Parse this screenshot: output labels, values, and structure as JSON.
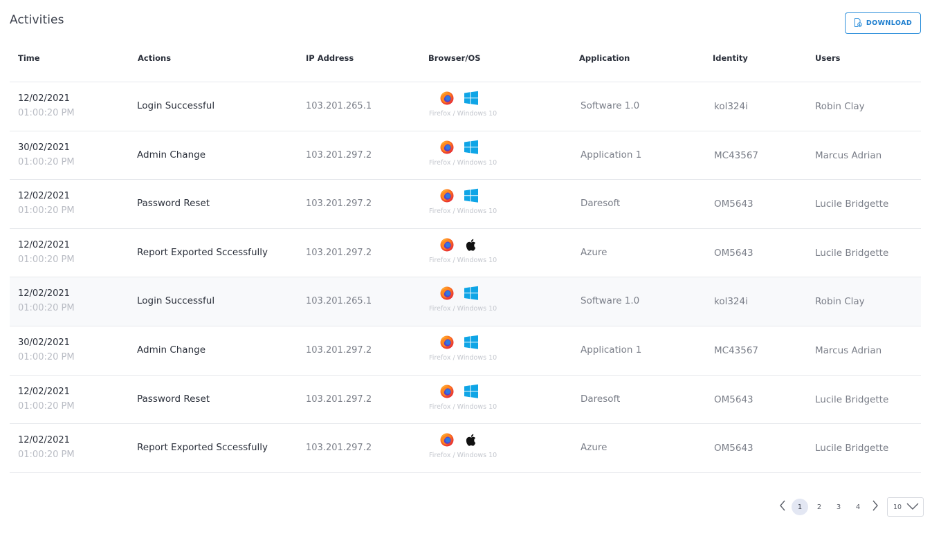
{
  "page": {
    "title": "Activities",
    "download_label": "DOWNLOAD"
  },
  "table": {
    "columns": [
      "Time",
      "Actions",
      "IP Address",
      "Browser/OS",
      "Application",
      "Identity",
      "Users"
    ],
    "rows": [
      {
        "date": "12/02/2021",
        "time": "01:00:20 PM",
        "action": "Login Successful",
        "ip": "103.201.265.1",
        "browser_icon": "firefox-icon",
        "os_icon": "windows-icon",
        "browser_os": "Firefox / Windows 10",
        "application": "Software 1.0",
        "identity": "kol324i",
        "user": "Robin Clay"
      },
      {
        "date": "30/02/2021",
        "time": "01:00:20 PM",
        "action": "Admin Change",
        "ip": "103.201.297.2",
        "browser_icon": "firefox-icon",
        "os_icon": "windows-icon",
        "browser_os": "Firefox / Windows 10",
        "application": "Application 1",
        "identity": "MC43567",
        "user": "Marcus Adrian"
      },
      {
        "date": "12/02/2021",
        "time": "01:00:20 PM",
        "action": "Password Reset",
        "ip": "103.201.297.2",
        "browser_icon": "firefox-icon",
        "os_icon": "windows-icon",
        "browser_os": "Firefox / Windows 10",
        "application": "Daresoft",
        "identity": "OM5643",
        "user": "Lucile Bridgette"
      },
      {
        "date": "12/02/2021",
        "time": "01:00:20 PM",
        "action": "Report Exported Sccessfully",
        "ip": "103.201.297.2",
        "browser_icon": "firefox-icon",
        "os_icon": "apple-icon",
        "browser_os": "Firefox / Windows 10",
        "application": "Azure",
        "identity": "OM5643",
        "user": "Lucile Bridgette"
      },
      {
        "date": "12/02/2021",
        "time": "01:00:20 PM",
        "action": "Login Successful",
        "ip": "103.201.265.1",
        "browser_icon": "firefox-icon",
        "os_icon": "windows-icon",
        "browser_os": "Firefox / Windows 10",
        "application": "Software 1.0",
        "identity": "kol324i",
        "user": "Robin Clay"
      },
      {
        "date": "30/02/2021",
        "time": "01:00:20 PM",
        "action": "Admin Change",
        "ip": "103.201.297.2",
        "browser_icon": "firefox-icon",
        "os_icon": "windows-icon",
        "browser_os": "Firefox / Windows 10",
        "application": "Application 1",
        "identity": "MC43567",
        "user": "Marcus Adrian"
      },
      {
        "date": "12/02/2021",
        "time": "01:00:20 PM",
        "action": "Password Reset",
        "ip": "103.201.297.2",
        "browser_icon": "firefox-icon",
        "os_icon": "windows-icon",
        "browser_os": "Firefox / Windows 10",
        "application": "Daresoft",
        "identity": "OM5643",
        "user": "Lucile Bridgette"
      },
      {
        "date": "12/02/2021",
        "time": "01:00:20 PM",
        "action": "Report Exported Sccessfully",
        "ip": "103.201.297.2",
        "browser_icon": "firefox-icon",
        "os_icon": "apple-icon",
        "browser_os": "Firefox / Windows 10",
        "application": "Azure",
        "identity": "OM5643",
        "user": "Lucile Bridgette"
      }
    ]
  },
  "pagination": {
    "pages": [
      "1",
      "2",
      "3",
      "4"
    ],
    "current": "1",
    "page_size": "10"
  },
  "colors": {
    "accent": "#2d8fdb",
    "windows_blue": "#0fa5e6",
    "firefox_orange": "#ff6d1b",
    "hover_row": "#f8f9fb"
  }
}
